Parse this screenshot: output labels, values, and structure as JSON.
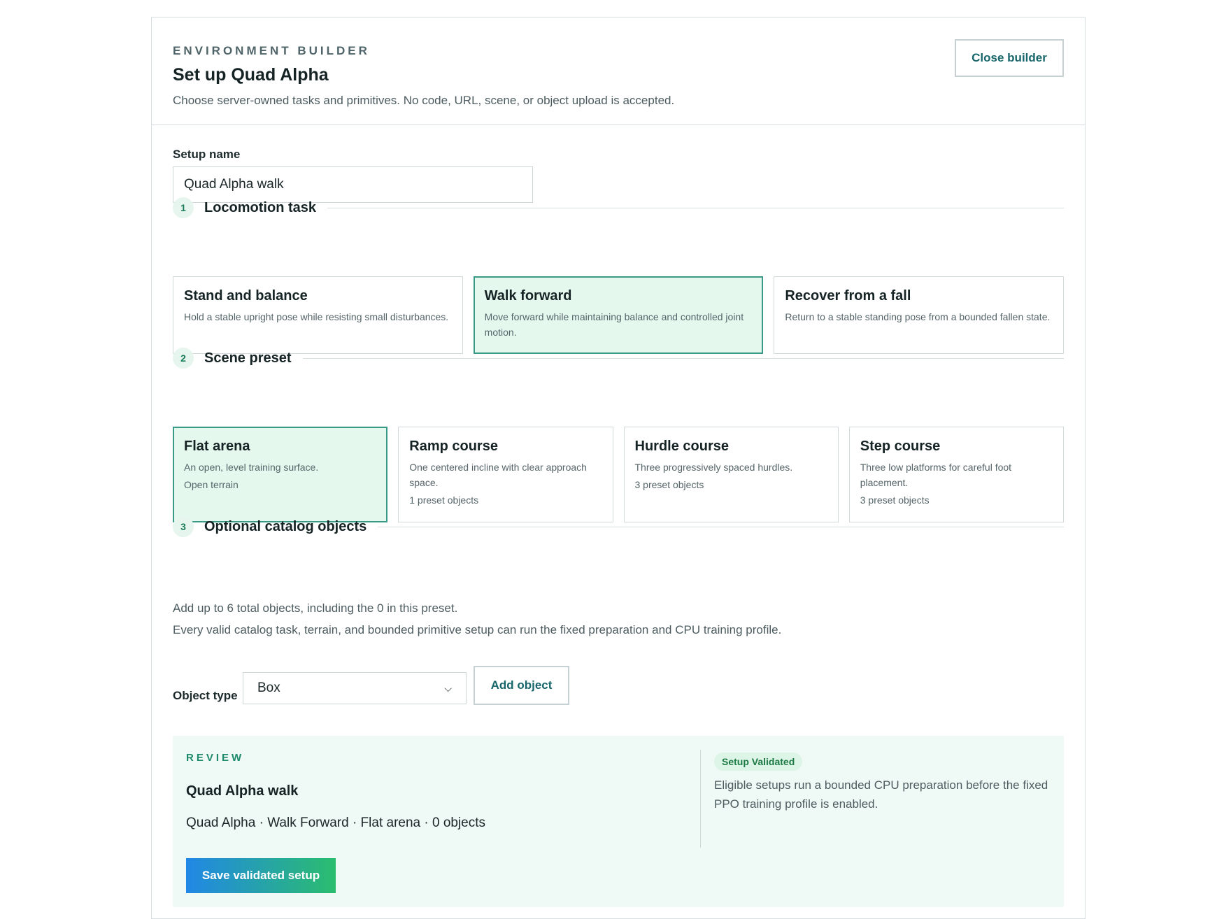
{
  "header": {
    "eyebrow": "ENVIRONMENT BUILDER",
    "title": "Set up Quad Alpha",
    "subtitle": "Choose server-owned tasks and primitives. No code, URL, scene, or object upload is accepted.",
    "close_label": "Close builder"
  },
  "setup": {
    "label": "Setup name",
    "value": "Quad Alpha walk"
  },
  "sections": [
    {
      "number": "1",
      "title": "Locomotion task"
    },
    {
      "number": "2",
      "title": "Scene preset"
    },
    {
      "number": "3",
      "title": "Optional catalog objects"
    }
  ],
  "tasks": [
    {
      "title": "Stand and balance",
      "desc": "Hold a stable upright pose while resisting small disturbances.",
      "selected": false
    },
    {
      "title": "Walk forward",
      "desc": "Move forward while maintaining balance and controlled joint motion.",
      "selected": true
    },
    {
      "title": "Recover from a fall",
      "desc": "Return to a stable standing pose from a bounded fallen state.",
      "selected": false
    }
  ],
  "scenes": [
    {
      "title": "Flat arena",
      "desc": "An open, level training surface.",
      "meta": "Open terrain",
      "selected": true
    },
    {
      "title": "Ramp course",
      "desc": "One centered incline with clear approach space.",
      "meta": "1 preset objects",
      "selected": false
    },
    {
      "title": "Hurdle course",
      "desc": "Three progressively spaced hurdles.",
      "meta": "3 preset objects",
      "selected": false
    },
    {
      "title": "Step course",
      "desc": "Three low platforms for careful foot placement.",
      "meta": "3 preset objects",
      "selected": false
    }
  ],
  "objects": {
    "help_1": "Add up to 6 total objects, including the 0 in this preset.",
    "help_2": "Every valid catalog task, terrain, and bounded primitive setup can run the fixed preparation and CPU training profile.",
    "type_label": "Object type",
    "selected_type": "Box",
    "add_label": "Add object"
  },
  "review": {
    "eyebrow": "REVIEW",
    "name": "Quad Alpha walk",
    "summary": "Quad Alpha · Walk Forward · Flat arena · 0 objects",
    "save_label": "Save validated setup",
    "badge": "Setup Validated",
    "note": "Eligible setups run a bounded CPU preparation before the fixed PPO training profile is enabled."
  },
  "colors": {
    "accent": "#16666b",
    "selected_bg": "#e4f8ee",
    "selected_border": "#3a9a88",
    "review_bg": "#eff9f5"
  }
}
